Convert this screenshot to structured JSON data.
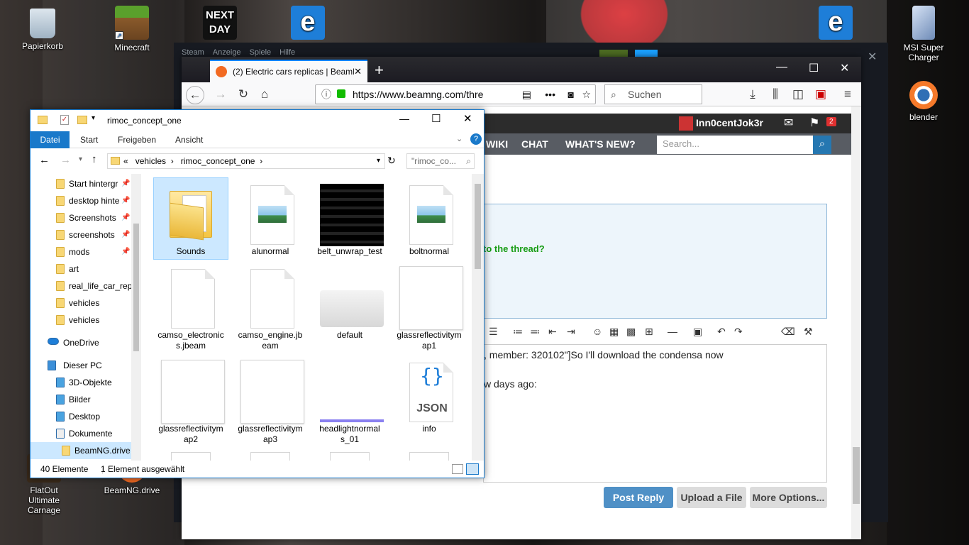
{
  "desktop": {
    "icons": [
      {
        "label": "Papierkorb",
        "icon": "recycle-bin-icon"
      },
      {
        "label": "Minecraft",
        "icon": "minecraft-icon"
      },
      {
        "label": "",
        "icon": "next-day-icon",
        "text": "NEXT DAY"
      },
      {
        "label": "",
        "icon": "edge-icon"
      },
      {
        "label": "",
        "icon": "edge-icon"
      },
      {
        "label": "MSI Super Charger",
        "icon": "msi-charger-icon"
      },
      {
        "label": "blender",
        "icon": "blender-icon"
      },
      {
        "label": "FlatOut Ultimate Carnage",
        "icon": "flatout-icon"
      },
      {
        "label": "BeamNG.drive",
        "icon": "beamng-icon"
      }
    ]
  },
  "steam": {
    "menu": [
      "Steam",
      "Anzeige",
      "Spiele",
      "Hilfe"
    ]
  },
  "firefox": {
    "tab_title": "(2) Electric cars replicas | BeamNG",
    "new_tab": "+",
    "url": "https://www.beamng.com/thre",
    "search_placeholder": "Suchen",
    "page": {
      "username": "Inn0centJok3r",
      "alerts_count": "2",
      "nav": [
        "WIKI",
        "CHAT",
        "WHAT'S NEW?"
      ],
      "search_placeholder": "Search...",
      "question": "to the thread?",
      "editor_line1": ", member: 320102\"]So I'll download the condensa now",
      "editor_line2": "w days ago:",
      "buttons": {
        "post": "Post Reply",
        "upload": "Upload a File",
        "more": "More Options..."
      }
    }
  },
  "explorer": {
    "title": "rimoc_concept_one",
    "ribbon_tabs": [
      "Datei",
      "Start",
      "Freigeben",
      "Ansicht"
    ],
    "path": [
      "vehicles",
      "rimoc_concept_one"
    ],
    "path_prefix": "«",
    "search_placeholder": "\"rimoc_co...",
    "nav_items": [
      {
        "label": "Start hintergr",
        "pinned": true
      },
      {
        "label": "desktop hinte",
        "pinned": true
      },
      {
        "label": "Screenshots",
        "pinned": true
      },
      {
        "label": "screenshots",
        "pinned": true
      },
      {
        "label": "mods",
        "pinned": true
      },
      {
        "label": "art",
        "pinned": false
      },
      {
        "label": "real_life_car_repl",
        "pinned": false
      },
      {
        "label": "vehicles",
        "pinned": false
      },
      {
        "label": "vehicles",
        "pinned": false
      },
      {
        "label": "OneDrive",
        "pinned": false
      },
      {
        "label": "Dieser PC",
        "pinned": false
      },
      {
        "label": "3D-Objekte",
        "pinned": false
      },
      {
        "label": "Bilder",
        "pinned": false
      },
      {
        "label": "Desktop",
        "pinned": false
      },
      {
        "label": "Dokumente",
        "pinned": false
      },
      {
        "label": "BeamNG.drive",
        "pinned": false
      }
    ],
    "files": [
      {
        "name": "Sounds",
        "kind": "folder",
        "selected": true
      },
      {
        "name": "alunormal",
        "kind": "image"
      },
      {
        "name": "belt_unwrap_test",
        "kind": "dark"
      },
      {
        "name": "boltnormal",
        "kind": "image"
      },
      {
        "name": "camso_electronic s.jbeam",
        "kind": "doc"
      },
      {
        "name": "camso_engine.jb eam",
        "kind": "doc"
      },
      {
        "name": "default",
        "kind": "car"
      },
      {
        "name": "glassreflectivitym ap1",
        "kind": "blank"
      },
      {
        "name": "glassreflectivitym ap2",
        "kind": "blank"
      },
      {
        "name": "glassreflectivitym ap3",
        "kind": "blank"
      },
      {
        "name": "headlightnormal s_01",
        "kind": "headlight"
      },
      {
        "name": "info",
        "kind": "json"
      }
    ],
    "json_label": "JSON",
    "status_count": "40 Elemente",
    "status_selected": "1 Element ausgewählt"
  }
}
